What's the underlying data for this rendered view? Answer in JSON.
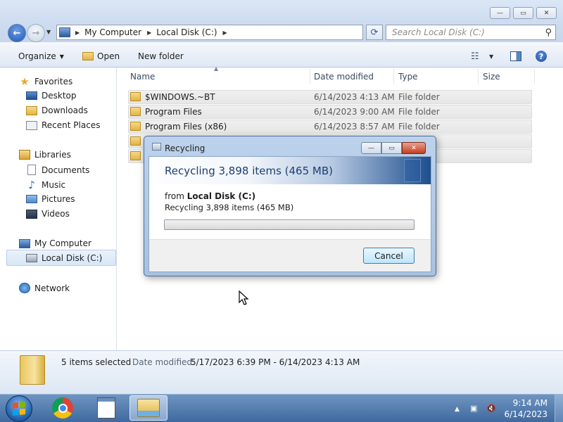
{
  "window": {
    "minimize_glyph": "—",
    "maximize_glyph": "▭",
    "close_glyph": "✕"
  },
  "address": {
    "crumbs": [
      "My Computer",
      "Local Disk (C:)"
    ],
    "search_placeholder": "Search Local Disk (C:)"
  },
  "toolbar": {
    "organize": "Organize",
    "open": "Open",
    "new_folder": "New folder"
  },
  "nav": {
    "favorites": "Favorites",
    "desktop": "Desktop",
    "downloads": "Downloads",
    "recent_places": "Recent Places",
    "libraries": "Libraries",
    "documents": "Documents",
    "music": "Music",
    "pictures": "Pictures",
    "videos": "Videos",
    "my_computer": "My Computer",
    "local_disk": "Local Disk (C:)",
    "network": "Network"
  },
  "columns": {
    "name": "Name",
    "date_modified": "Date modified",
    "type": "Type",
    "size": "Size"
  },
  "files": [
    {
      "name": "$WINDOWS.~BT",
      "date": "6/14/2023 4:13 AM",
      "type": "File folder"
    },
    {
      "name": "Program Files",
      "date": "6/14/2023 9:00 AM",
      "type": "File folder"
    },
    {
      "name": "Program Files (x86)",
      "date": "6/14/2023 8:57 AM",
      "type": "File folder"
    }
  ],
  "details": {
    "selection": "5 items selected",
    "date_label": "Date modified:",
    "date_range": "5/17/2023 6:39 PM - 6/14/2023 4:13 AM"
  },
  "dialog": {
    "title": "Recycling",
    "heading": "Recycling 3,898 items (465 MB)",
    "from_label": "from",
    "from_location": "Local Disk (C:)",
    "status": "Recycling 3,898 items (465 MB)",
    "progress": 0,
    "cancel": "Cancel"
  },
  "taskbar": {
    "time": "9:14 AM",
    "date": "6/14/2023",
    "tray_expand": "▲"
  },
  "colors": {
    "accent": "#2a5aa7",
    "selection": "#d7e6f8",
    "close_button": "#c43d1f"
  },
  "icons": [
    "back-arrow-icon",
    "forward-arrow-icon",
    "computer-icon",
    "refresh-icon",
    "search-icon",
    "folder-icon",
    "star-icon",
    "desktop-icon",
    "downloads-icon",
    "recent-places-icon",
    "libraries-icon",
    "documents-icon",
    "music-icon",
    "pictures-icon",
    "videos-icon",
    "disk-icon",
    "network-icon",
    "recycle-icon",
    "windows-logo-icon",
    "chrome-icon",
    "notepad-icon",
    "explorer-icon",
    "network-tray-icon",
    "volume-muted-icon"
  ]
}
